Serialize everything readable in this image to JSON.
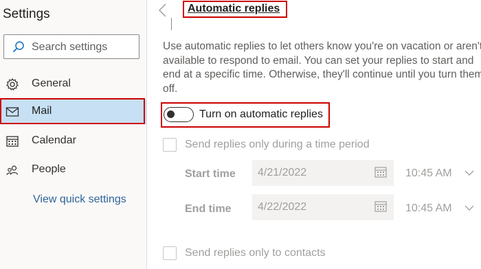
{
  "sidebar": {
    "title": "Settings",
    "search_placeholder": "Search settings",
    "items": [
      {
        "label": "General",
        "icon": "gear-icon"
      },
      {
        "label": "Mail",
        "icon": "mail-icon",
        "active": true
      },
      {
        "label": "Calendar",
        "icon": "calendar-icon"
      },
      {
        "label": "People",
        "icon": "people-icon"
      }
    ],
    "quick_link": "View quick settings"
  },
  "main": {
    "title": "Automatic replies",
    "description": "Use automatic replies to let others know you're on vacation or aren't available to respond to email. You can set your replies to start and end at a specific time. Otherwise, they'll continue until you turn them off.",
    "toggle_label": "Turn on automatic replies",
    "toggle_on": false,
    "time_period_label": "Send replies only during a time period",
    "start_label": "Start time",
    "start_date": "4/21/2022",
    "start_time": "10:45 AM",
    "end_label": "End time",
    "end_date": "4/22/2022",
    "end_time": "10:45 AM",
    "contacts_label": "Send replies only to contacts"
  },
  "colors": {
    "highlight": "#cc0000",
    "active_nav": "#c7e0f4",
    "link": "#2f6497",
    "disabled_text": "#a19f9d"
  }
}
